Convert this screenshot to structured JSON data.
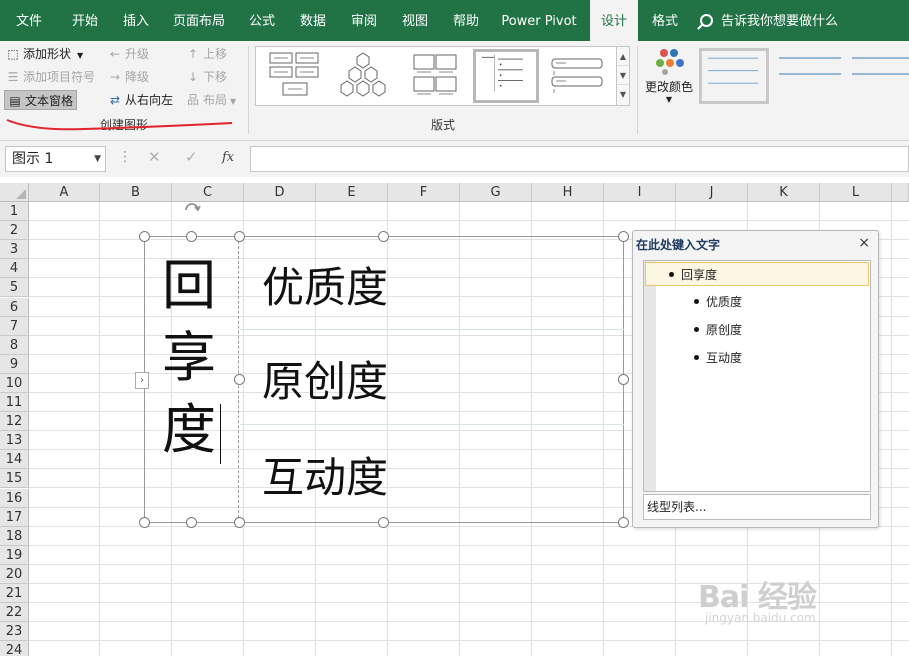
{
  "ribbon": {
    "tabs": [
      "文件",
      "开始",
      "插入",
      "页面布局",
      "公式",
      "数据",
      "审阅",
      "视图",
      "帮助",
      "Power Pivot",
      "设计",
      "格式"
    ],
    "active_tab": "设计",
    "tell_me": "告诉我你想要做什么",
    "create_graphic": {
      "add_shape": "添加形状",
      "add_bullet": "添加项目符号",
      "text_pane": "文本窗格",
      "promote": "升级",
      "demote": "降级",
      "right_to_left": "从右向左",
      "move_up": "上移",
      "move_down": "下移",
      "layout": "布局",
      "group_label": "创建图形"
    },
    "layouts_group_label": "版式",
    "change_colors": "更改颜色",
    "accent_color": "#217346"
  },
  "formula_bar": {
    "name_box": "图示 1",
    "fx": "fx",
    "cancel_glyph": "✕",
    "enter_glyph": "✓"
  },
  "grid": {
    "columns": [
      "A",
      "B",
      "C",
      "D",
      "E",
      "F",
      "G",
      "H",
      "I",
      "J",
      "K",
      "L"
    ],
    "rows": [
      "1",
      "2",
      "3",
      "4",
      "5",
      "6",
      "7",
      "8",
      "9",
      "10",
      "11",
      "12",
      "13",
      "14",
      "15",
      "16",
      "17",
      "18",
      "19",
      "20",
      "21",
      "22",
      "23",
      "24"
    ]
  },
  "smartart": {
    "main_chars": [
      "回",
      "享",
      "度"
    ],
    "items": [
      "优质度",
      "原创度",
      "互动度"
    ]
  },
  "text_pane": {
    "title": "在此处键入文字",
    "close": "×",
    "root": "回享度",
    "children": [
      "优质度",
      "原创度",
      "互动度"
    ],
    "footer": "线型列表..."
  },
  "watermark": {
    "logo": "Bai 经验",
    "url": "jingyan.baidu.com"
  }
}
